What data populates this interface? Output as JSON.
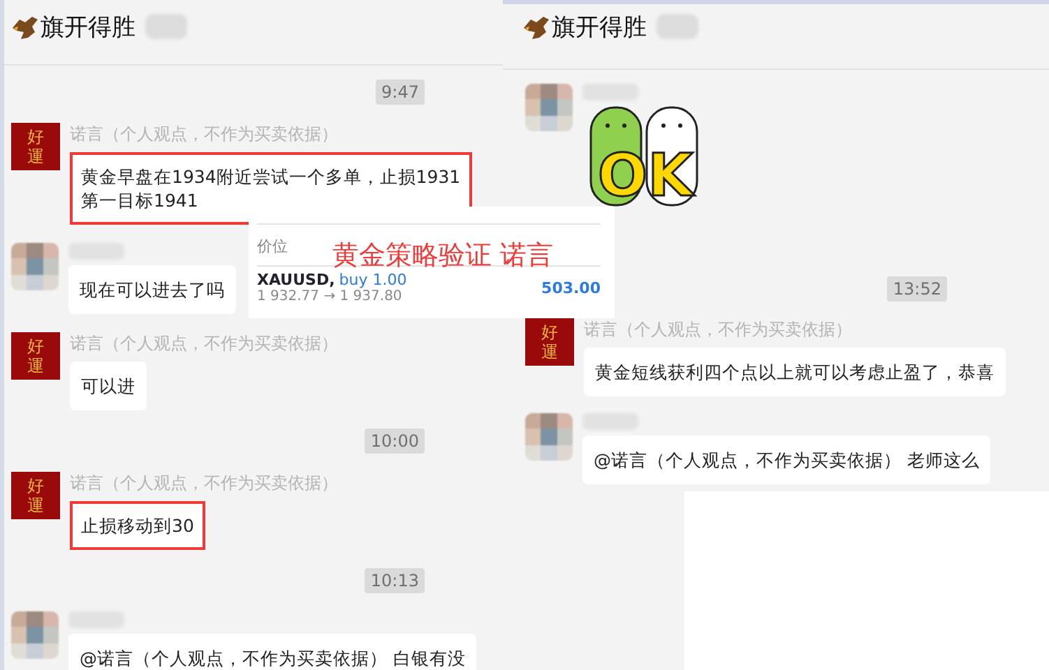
{
  "panels": [
    {
      "title": "旗开得胜",
      "messages": [
        {
          "kind": "time",
          "text": "9:47"
        },
        {
          "kind": "text",
          "avatar": {
            "kind": "lucky",
            "text": "好運"
          },
          "sender": "诺言（个人观点，不作为买卖依据）",
          "text": "黄金早盘在1934附近尝试一个多单，止损1931\n第一目标1941",
          "highlighted": true
        },
        {
          "kind": "text",
          "avatar": {
            "kind": "blurred"
          },
          "text": "现在可以进去了吗",
          "highlighted": false
        },
        {
          "kind": "text",
          "avatar": {
            "kind": "lucky",
            "text": "好運"
          },
          "sender": "诺言（个人观点，不作为买卖依据）",
          "text": "可以进",
          "highlighted": false
        },
        {
          "kind": "time",
          "text": "10:00"
        },
        {
          "kind": "text",
          "avatar": {
            "kind": "lucky",
            "text": "好運"
          },
          "sender": "诺言（个人观点，不作为买卖依据）",
          "text": "止损移动到30",
          "highlighted": true
        },
        {
          "kind": "time",
          "text": "10:13"
        },
        {
          "kind": "text",
          "avatar": {
            "kind": "blurred"
          },
          "text": "@诺言（个人观点，不作为买卖依据） 白银有没",
          "highlighted": false
        }
      ]
    },
    {
      "title": "旗开得胜",
      "messages": [
        {
          "kind": "sticker",
          "avatar": {
            "kind": "blurred"
          },
          "text": "OK"
        },
        {
          "kind": "time",
          "text": "13:52"
        },
        {
          "kind": "text",
          "avatar": {
            "kind": "lucky",
            "text": "好運"
          },
          "sender": "诺言（个人观点，不作为买卖依据）",
          "text": "黄金短线获利四个点以上就可以考虑止盈了，恭喜",
          "highlighted": false
        },
        {
          "kind": "text",
          "avatar": {
            "kind": "blurred"
          },
          "text": "@诺言（个人观点，不作为买卖依据） 老师这么",
          "highlighted": false
        }
      ]
    }
  ],
  "trade_card": {
    "label": "价位",
    "symbol": "XAUUSD,",
    "order": "buy 1.00",
    "prices": "1 932.77 → 1 937.80",
    "profit": "503.00"
  },
  "caption": "黄金策略验证 诺言"
}
